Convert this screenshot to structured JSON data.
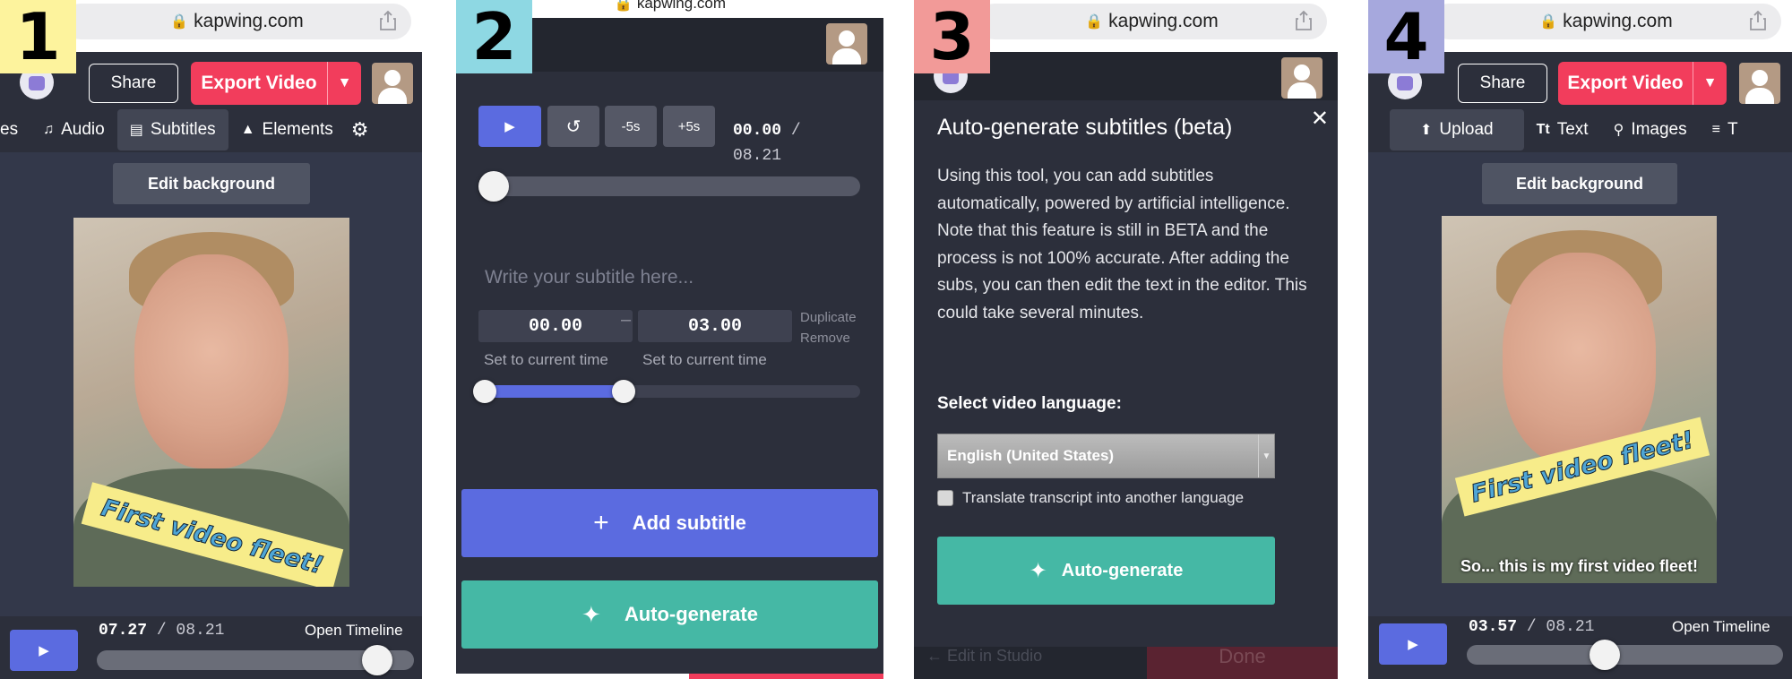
{
  "colors": {
    "accent_blue": "#5b6be0",
    "export_red": "#f23d5c",
    "teal": "#45b8a5",
    "bg_dark": "#2c2f3b"
  },
  "panel1": {
    "badge": "1",
    "badge_color": "#fdf39d",
    "url": "kapwing.com",
    "share": "Share",
    "export": "Export Video",
    "tabs": [
      {
        "label": "es",
        "icon": ""
      },
      {
        "label": "Audio",
        "icon": "music-note-icon"
      },
      {
        "label": "Subtitles",
        "icon": "subtitles-icon"
      },
      {
        "label": "Elements",
        "icon": "shapes-icon"
      }
    ],
    "edit_bg": "Edit background",
    "sticker": "First video fleet!",
    "time_current": "07.27",
    "time_total": "08.21",
    "timeline_position": 0.885,
    "open_timeline": "Open Timeline"
  },
  "panel2": {
    "badge": "2",
    "badge_color": "#8ed8e3",
    "url": "kapwing.com",
    "buttons": {
      "play": "▶",
      "reset": "↺",
      "minus5": "-5s",
      "plus5": "+5s"
    },
    "time_current": "00.00",
    "time_total": "08.21",
    "playhead_position": 0,
    "subtitle_placeholder": "Write your subtitle here...",
    "start": "00.00",
    "end": "03.00",
    "dash": "–",
    "duplicate": "Duplicate",
    "remove": "Remove",
    "set_current": "Set to current time",
    "range_start": 0,
    "range_end": 0.365,
    "add_subtitle": "Add subtitle",
    "auto_generate": "Auto-generate"
  },
  "panel3": {
    "badge": "3",
    "badge_color": "#f29a98",
    "url": "kapwing.com",
    "title": "Auto-generate subtitles (beta)",
    "body": "Using this tool, you can add subtitles automatically, powered by artificial intelligence. Note that this feature is still in BETA and the process is not 100% accurate. After adding the subs, you can then edit the text in the editor. This could take several minutes.",
    "language_label": "Select video language:",
    "language_value": "English (United States)",
    "translate_label": "Translate transcript into another language",
    "auto_generate": "Auto-generate",
    "behind_left": "Edit in Studio",
    "behind_right": "Done"
  },
  "panel4": {
    "badge": "4",
    "badge_color": "#a6a8dd",
    "url": "kapwing.com",
    "share": "Share",
    "export": "Export Video",
    "tabs": [
      {
        "label": "Upload",
        "icon": "upload-icon"
      },
      {
        "label": "Text",
        "icon": "text-icon"
      },
      {
        "label": "Images",
        "icon": "search-icon"
      },
      {
        "label": "T",
        "icon": "list-icon"
      }
    ],
    "edit_bg": "Edit background",
    "sticker": "First video fleet!",
    "caption": "So... this is my first video fleet!",
    "time_current": "03.57",
    "time_total": "08.21",
    "timeline_position": 0.435,
    "open_timeline": "Open Timeline"
  }
}
